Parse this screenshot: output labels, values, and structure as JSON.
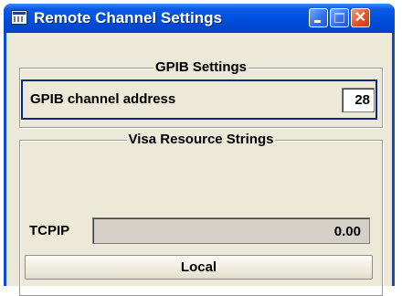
{
  "window": {
    "title": "Remote Channel Settings",
    "app_icon": "settings-dialog-icon",
    "buttons": [
      "minimize-icon",
      "maximize-icon",
      "close-icon"
    ],
    "close_glyph": "✕"
  },
  "gpib": {
    "group_title": "GPIB Settings",
    "channel_address_label": "GPIB channel address",
    "channel_address_value": "28"
  },
  "visa": {
    "group_title": "Visa Resource Strings",
    "tcpip_label": "TCPIP",
    "tcpip_value": "0.00",
    "local_button": "Local"
  },
  "colors": {
    "titlebar": "#0050e0",
    "dialog_background": "#ece9d8",
    "close_button": "#e2522a",
    "selected_row_border": "#0b2a7a"
  }
}
